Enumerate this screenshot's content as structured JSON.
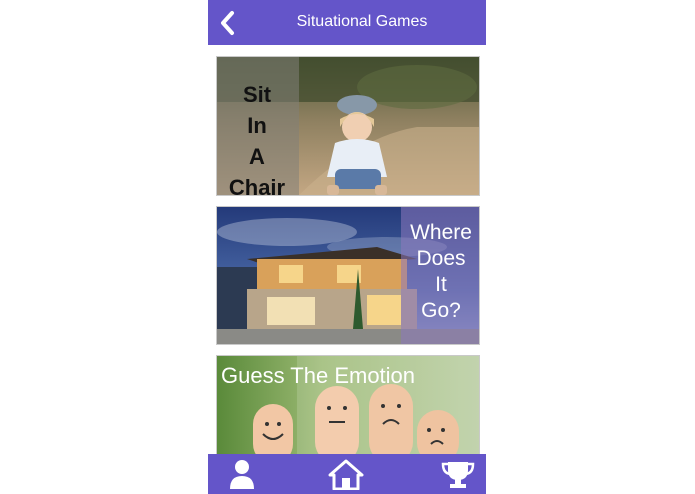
{
  "header": {
    "title": "Situational Games",
    "back_icon": "chevron-left-icon"
  },
  "cards": [
    {
      "label": "Sit In A Chair",
      "image": "child-sitting-photo"
    },
    {
      "label": "Where Does It Go?",
      "image": "house-at-dusk-photo"
    },
    {
      "label": "Guess The Emotion",
      "image": "finger-faces-photo"
    }
  ],
  "bottom_nav": {
    "items": [
      {
        "icon": "profile-icon"
      },
      {
        "icon": "home-icon"
      },
      {
        "icon": "trophy-icon"
      }
    ]
  },
  "colors": {
    "brand": "#6455c9",
    "nav_icon": "#ffffff"
  }
}
